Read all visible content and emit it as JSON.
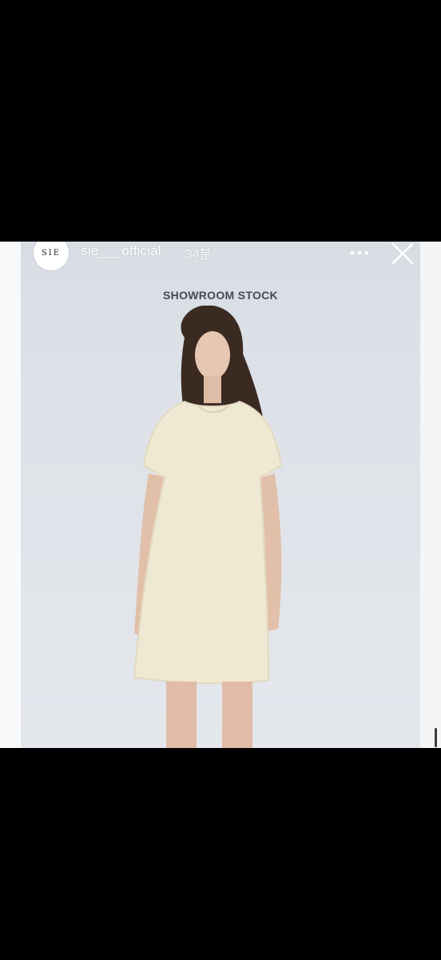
{
  "story": {
    "account_name": "sie___official",
    "avatar_text": "SIE",
    "posted_time": "34분",
    "more_icon": "more-horizontal-icon",
    "close_icon": "close-icon",
    "overlay_title": "SHOWROOM STOCK"
  },
  "photo": {
    "subject": "model-in-cream-tweed-dress",
    "background_color": "#dfe3e9",
    "dress_color": "#efe8d2"
  }
}
